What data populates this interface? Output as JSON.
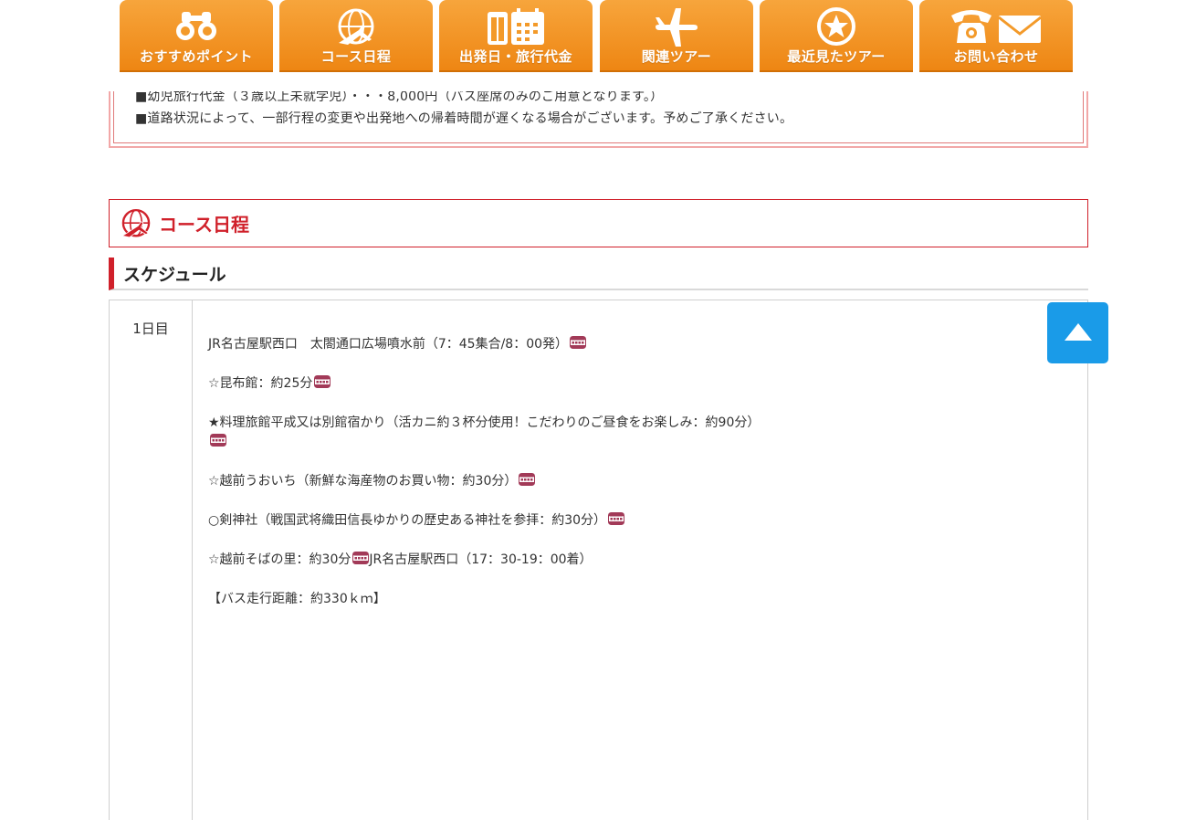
{
  "notice": {
    "line1": "■幼児旅行代金（３歳以上未就学児）・・・8,000円（バス座席のみのご用意となります。）",
    "line2": "■道路状況によって、一部行程の変更や出発地への帰着時間が遅くなる場合がございます。予めご了承ください。"
  },
  "nav": [
    {
      "label": "おすすめポイント",
      "icon": "binoculars-icon"
    },
    {
      "label": "コース日程",
      "icon": "globe-plane-icon"
    },
    {
      "label": "出発日・旅行代金",
      "icon": "calendar-icon"
    },
    {
      "label": "関連ツアー",
      "icon": "airplane-icon"
    },
    {
      "label": "最近見たツアー",
      "icon": "star-circle-icon"
    },
    {
      "label": "お問い合わせ",
      "icon": "phone-mail-icon"
    }
  ],
  "course": {
    "title": "コース日程",
    "icon": "globe-plane-icon"
  },
  "schedule": {
    "title": "スケジュール",
    "day": "1日目",
    "items": [
      {
        "text": "JR名古屋駅西口　太閤通口広場噴水前（7：45集合/8：00発）",
        "bus": true
      },
      {
        "text": "☆昆布館：約25分",
        "bus": true
      },
      {
        "text": "★料理旅館平成又は別館宿かり（活カニ約３杯分使用！こだわりのご昼食をお楽しみ：約90分）",
        "bus": true
      },
      {
        "text": "☆越前うおいち（新鮮な海産物のお買い物：約30分）",
        "bus": true
      },
      {
        "text": "○剣神社（戦国武将織田信長ゆかりの歴史ある神社を参拝：約30分）",
        "bus": true
      },
      {
        "text": "☆越前そばの里：約30分",
        "bus": true,
        "after": "JR名古屋駅西口（17：30-19：00着）"
      },
      {
        "text": "【バス走行距離：約330ｋｍ】",
        "bus": false
      }
    ]
  },
  "icons": {
    "bus": "bus-icon",
    "to_top": "arrow-up-icon"
  },
  "colors": {
    "nav_orange": "#f39a2a",
    "accent_red": "#d0202a",
    "to_top_blue": "#1a9be8"
  }
}
